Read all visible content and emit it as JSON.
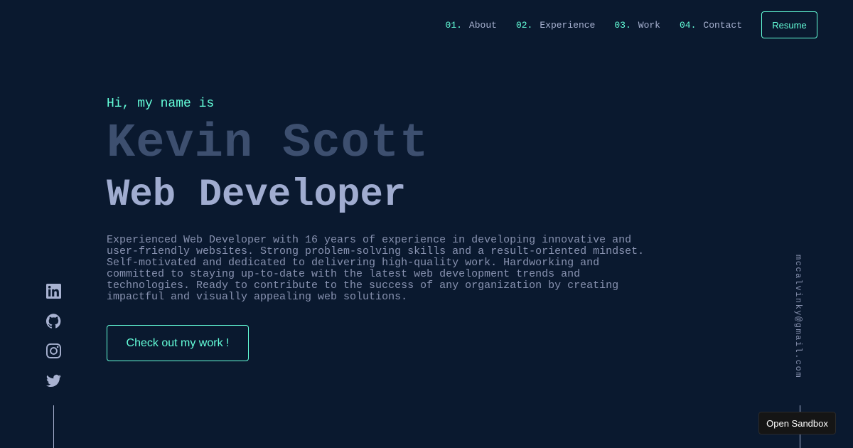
{
  "nav": {
    "items": [
      {
        "num": "01.",
        "label": "About"
      },
      {
        "num": "02.",
        "label": "Experience"
      },
      {
        "num": "03.",
        "label": "Work"
      },
      {
        "num": "04.",
        "label": "Contact"
      }
    ],
    "resume_label": "Resume"
  },
  "hero": {
    "greeting": "Hi, my name is",
    "name": "Kevin Scott",
    "role": "Web Developer",
    "bio": "Experienced Web Developer with 16 years of experience in developing innovative and user-friendly websites. Strong problem-solving skills and a result-oriented mindset. Self-motivated and dedicated to delivering high-quality work. Hardworking and committed to staying up-to-date with the latest web development trends and technologies. Ready to contribute to the success of any organization by creating impactful and visually appealing web solutions.",
    "cta_label": "Check out my work !"
  },
  "social": {
    "icons": [
      "linkedin-icon",
      "github-icon",
      "instagram-icon",
      "twitter-icon"
    ]
  },
  "email": "mccalvinky@gmail.com",
  "sandbox_label": "Open Sandbox",
  "colors": {
    "background": "#0a192f",
    "accent": "#64ffda",
    "text": "#8892b0",
    "heading": "#a0acd0",
    "name": "#3d4f6f"
  }
}
